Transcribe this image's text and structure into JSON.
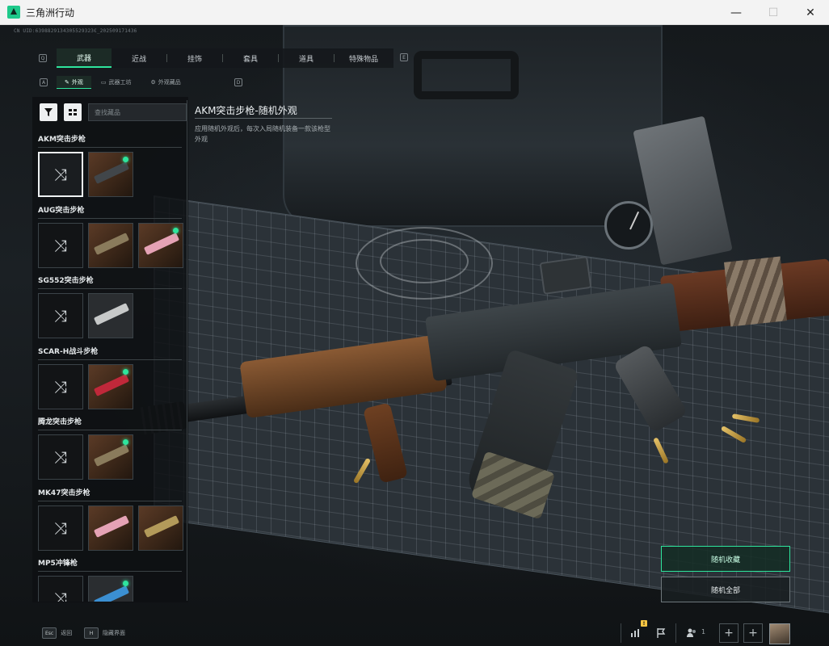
{
  "window": {
    "title": "三角洲行动",
    "controls": {
      "minimize": "—",
      "maximize": "☐",
      "close": "✕"
    }
  },
  "uid_line": "CN UID:6398829134305529323€_202509171436",
  "tabs": {
    "left_key": "Q",
    "right_key": "E",
    "items": [
      {
        "label": "武器",
        "active": true
      },
      {
        "label": "近战",
        "active": false
      },
      {
        "label": "挂饰",
        "active": false
      },
      {
        "label": "套具",
        "active": false
      },
      {
        "label": "道具",
        "active": false
      },
      {
        "label": "特殊物品",
        "active": false
      }
    ]
  },
  "subtabs": {
    "left_key": "A",
    "right_key": "D",
    "items": [
      {
        "label": "外观",
        "icon": "✎",
        "active": true
      },
      {
        "label": "武器工坊",
        "icon": "▭",
        "active": false
      },
      {
        "label": "外观藏品",
        "icon": "⚙",
        "active": false
      }
    ]
  },
  "search": {
    "placeholder": "查找藏品"
  },
  "detail": {
    "title": "AKM突击步枪-随机外观",
    "description": "应用随机外观后，每次入局随机装备一款该枪型外观"
  },
  "weapon_groups": [
    {
      "name": "AKM突击步枪",
      "tiles": [
        {
          "type": "random",
          "selected": true
        },
        {
          "type": "skin",
          "color": "dark",
          "equipped": true
        }
      ]
    },
    {
      "name": "AUG突击步枪",
      "tiles": [
        {
          "type": "random"
        },
        {
          "type": "skin",
          "color": "camo"
        },
        {
          "type": "skin",
          "color": "pink",
          "equipped": true
        }
      ]
    },
    {
      "name": "SG552突击步枪",
      "tiles": [
        {
          "type": "random"
        },
        {
          "type": "skin",
          "color": "silver"
        }
      ]
    },
    {
      "name": "SCAR-H战斗步枪",
      "tiles": [
        {
          "type": "random"
        },
        {
          "type": "skin",
          "color": "red",
          "equipped": true
        }
      ]
    },
    {
      "name": "腾龙突击步枪",
      "tiles": [
        {
          "type": "random"
        },
        {
          "type": "skin",
          "color": "camo",
          "equipped": true
        }
      ]
    },
    {
      "name": "MK47突击步枪",
      "tiles": [
        {
          "type": "random"
        },
        {
          "type": "skin",
          "color": "pink"
        },
        {
          "type": "skin",
          "color": "gold"
        }
      ]
    },
    {
      "name": "MP5冲锋枪",
      "tiles": [
        {
          "type": "random"
        },
        {
          "type": "skin",
          "color": "blue",
          "equipped": true
        }
      ]
    }
  ],
  "actions": {
    "random_collection": "随机收藏",
    "random_all": "随机全部"
  },
  "bottom": {
    "back_key": "Esc",
    "back_label": "返回",
    "hide_key": "H",
    "hide_label": "隐藏界面",
    "notif_badge": "!",
    "friend_count": "1",
    "add_symbol": "+"
  },
  "colors": {
    "accent": "#2ee59d",
    "badge": "#f5c542"
  }
}
